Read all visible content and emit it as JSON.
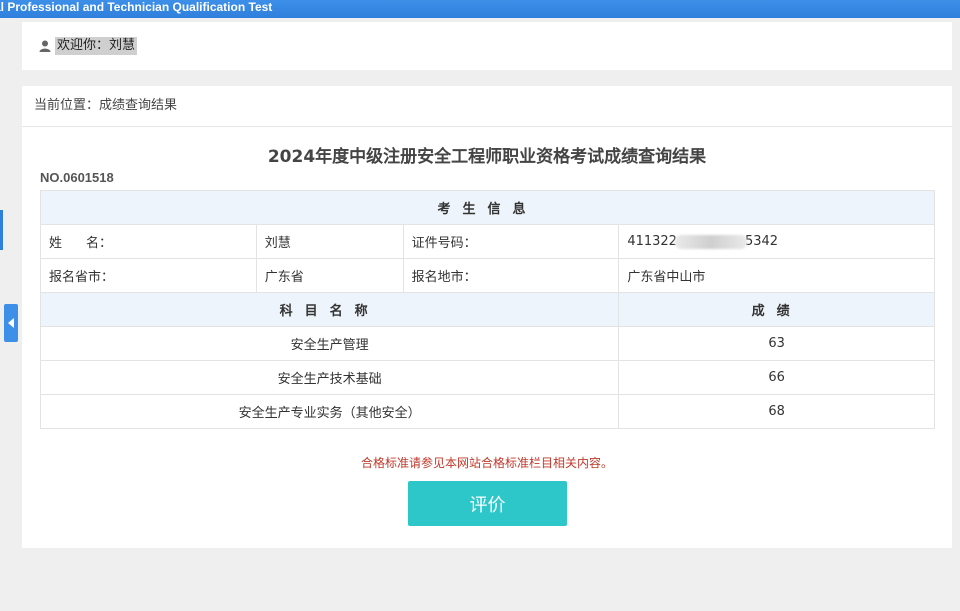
{
  "header": {
    "title": "al Professional and Technician Qualification Test"
  },
  "welcome": {
    "text": "欢迎你：刘慧"
  },
  "breadcrumb": "当前位置：成绩查询结果",
  "page_title": "2024年度中级注册安全工程师职业资格考试成绩查询结果",
  "serial_no": "NO.0601518",
  "candidate": {
    "section_header": "考生信息",
    "name_label_a": "姓",
    "name_label_b": "名：",
    "name": "刘慧",
    "id_label": "证件号码：",
    "id_prefix": "411322",
    "id_suffix": "5342",
    "province_label": "报名省市：",
    "province": "广东省",
    "city_label": "报名地市：",
    "city": "广东省中山市"
  },
  "scores": {
    "subject_header": "科目名称",
    "score_header": "成绩",
    "rows": [
      {
        "subject": "安全生产管理",
        "score": "63"
      },
      {
        "subject": "安全生产技术基础",
        "score": "66"
      },
      {
        "subject": "安全生产专业实务（其他安全）",
        "score": "68"
      }
    ]
  },
  "note": "合格标准请参见本网站合格标准栏目相关内容。",
  "evaluate_button": "评价",
  "colors": {
    "brand_blue": "#3d8fe8",
    "button_teal": "#2ec7c9",
    "note_red": "#c0392b"
  },
  "icons": {
    "user": "user-icon",
    "collapse": "chevron-left-icon"
  }
}
